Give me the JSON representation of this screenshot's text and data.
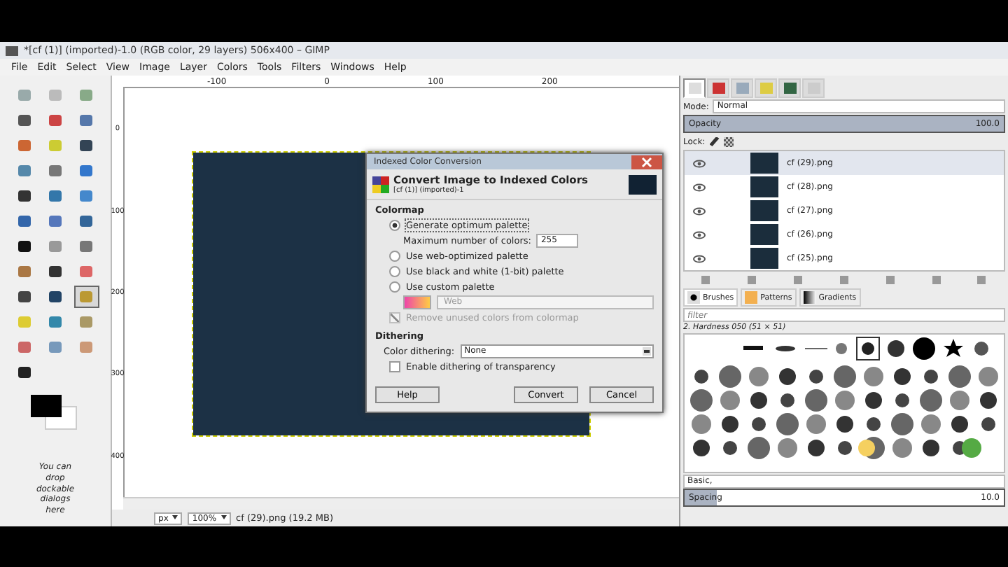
{
  "window": {
    "title": "*[cf (1)] (imported)-1.0 (RGB color, 29 layers) 506x400 – GIMP"
  },
  "menu": [
    "File",
    "Edit",
    "Select",
    "View",
    "Image",
    "Layer",
    "Colors",
    "Tools",
    "Filters",
    "Windows",
    "Help"
  ],
  "toolbox": {
    "tools": [
      {
        "selected": false
      },
      {
        "selected": false
      },
      {
        "selected": false
      },
      {
        "selected": false
      },
      {
        "selected": false
      },
      {
        "selected": false
      },
      {
        "selected": false
      },
      {
        "selected": false
      },
      {
        "selected": false
      },
      {
        "selected": false
      },
      {
        "selected": false
      },
      {
        "selected": false
      },
      {
        "selected": false
      },
      {
        "selected": false
      },
      {
        "selected": false
      },
      {
        "selected": false
      },
      {
        "selected": false
      },
      {
        "selected": false
      },
      {
        "selected": false
      },
      {
        "selected": false
      },
      {
        "selected": false
      },
      {
        "selected": false
      },
      {
        "selected": false
      },
      {
        "selected": false
      },
      {
        "selected": false
      },
      {
        "selected": false
      },
      {
        "selected": true
      },
      {
        "selected": false
      },
      {
        "selected": false
      },
      {
        "selected": false
      },
      {
        "selected": false
      },
      {
        "selected": false
      },
      {
        "selected": false
      },
      {
        "selected": false
      }
    ],
    "dock_hint": "You can drop dockable dialogs here"
  },
  "rulers": {
    "horizontal": [
      "-100",
      "0",
      "100",
      "200"
    ],
    "vertical": [
      "0",
      "100",
      "200",
      "300",
      "400"
    ]
  },
  "dialog": {
    "title": "Indexed Color Conversion",
    "heading": "Convert Image to Indexed Colors",
    "subtitle": "[cf (1)] (imported)-1",
    "colormap_label": "Colormap",
    "options": [
      {
        "label": "Generate optimum palette",
        "selected": true
      },
      {
        "label": "Use web-optimized palette",
        "selected": false
      },
      {
        "label": "Use black and white (1-bit) palette",
        "selected": false
      },
      {
        "label": "Use custom palette",
        "selected": false
      }
    ],
    "max_colors_label": "Maximum number of colors:",
    "max_colors": "255",
    "palette": "Web",
    "remove_unused": {
      "label": "Remove unused colors from colormap",
      "checked": true,
      "disabled": true
    },
    "dithering_label": "Dithering",
    "color_dithering_label": "Color dithering:",
    "color_dithering": "None",
    "transparency": {
      "label": "Enable dithering of transparency",
      "checked": false
    },
    "buttons": [
      "Help",
      "Convert",
      "Cancel"
    ]
  },
  "status_bar": {
    "unit": "px",
    "zoom": "100%",
    "info": "cf (29).png (19.2 MB)"
  },
  "layers_panel": {
    "tabs": [
      {
        "selected": true
      },
      {
        "selected": false
      },
      {
        "selected": false
      },
      {
        "selected": false
      },
      {
        "selected": false
      },
      {
        "selected": false
      }
    ],
    "mode_label": "Mode:",
    "mode": "Normal",
    "opacity_label": "Opacity",
    "opacity": "100.0",
    "opacity_slider": {
      "level": 1
    },
    "lock_label": "Lock:",
    "layers": [
      {
        "name": "cf (29).png",
        "selected": true
      },
      {
        "name": "cf (28).png",
        "selected": false
      },
      {
        "name": "cf (27).png",
        "selected": false
      },
      {
        "name": "cf (26).png",
        "selected": false
      },
      {
        "name": "cf (25).png",
        "selected": false
      }
    ]
  },
  "brushes_panel": {
    "tabs": [
      {
        "label": "Brushes",
        "selected": true
      },
      {
        "label": "Patterns",
        "selected": false
      },
      {
        "label": "Gradients",
        "selected": false
      }
    ],
    "filter_placeholder": "filter",
    "brush_name": "2. Hardness 050 (51 × 51)",
    "tag": "Basic,",
    "spacing_label": "Spacing",
    "spacing": "10.0",
    "spacing_slider": {
      "level": 0.1
    }
  }
}
